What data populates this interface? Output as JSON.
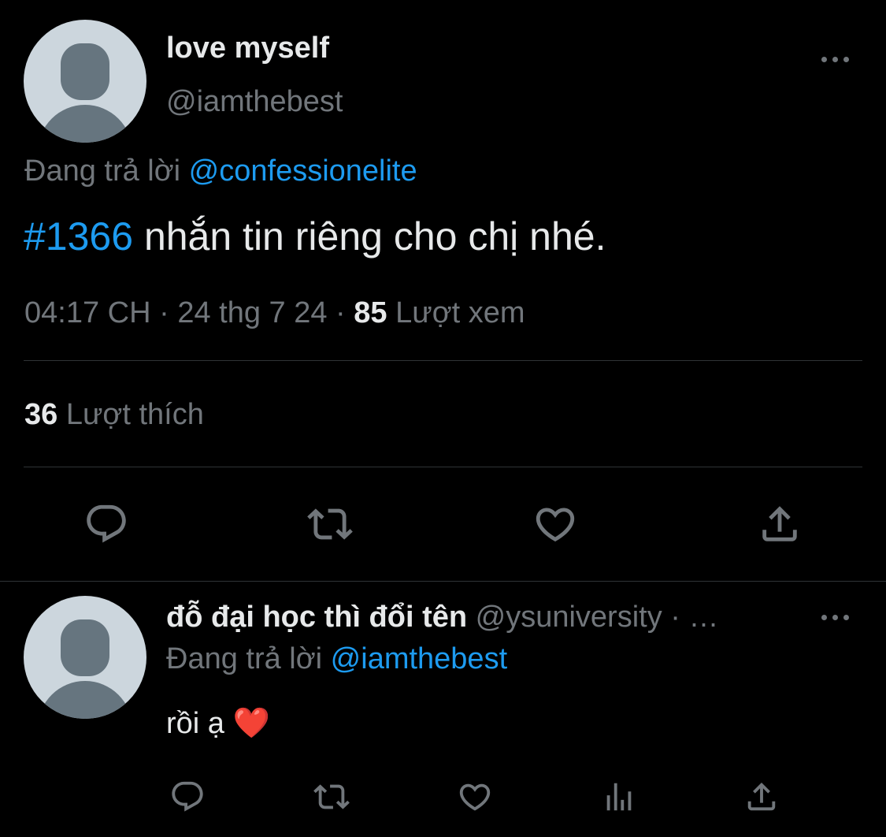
{
  "main_tweet": {
    "display_name": "love myself",
    "handle": "@iamthebest",
    "replying_prefix": "Đang trả lời",
    "replying_to": "@confessionelite",
    "hashtag": "#1366",
    "text": " nhắn tin riêng cho chị nhé.",
    "time": "04:17 CH",
    "separator": " · ",
    "date": "24 thg 7 24",
    "views_count": "85",
    "views_label": "Lượt xem",
    "likes_count": "36",
    "likes_label": "Lượt thích",
    "actions": [
      "reply-icon",
      "retweet-icon",
      "like-icon",
      "share-icon"
    ]
  },
  "reply_tweet": {
    "display_name": "đỗ đại học thì đổi tên",
    "handle": "@ysuniversity",
    "truncation": "· …",
    "replying_prefix": "Đang trả lời",
    "replying_to": "@iamthebest",
    "text": "rồi ạ",
    "emoji": "❤️",
    "actions": [
      "reply-icon",
      "retweet-icon",
      "like-icon",
      "analytics-icon",
      "share-icon"
    ]
  },
  "colors": {
    "background": "#000000",
    "text": "#e7e9ea",
    "muted": "#71767b",
    "accent": "#1d9bf0",
    "divider": "#2f3336",
    "avatar_bg": "#ccd6dd",
    "avatar_fg": "#66757f"
  }
}
